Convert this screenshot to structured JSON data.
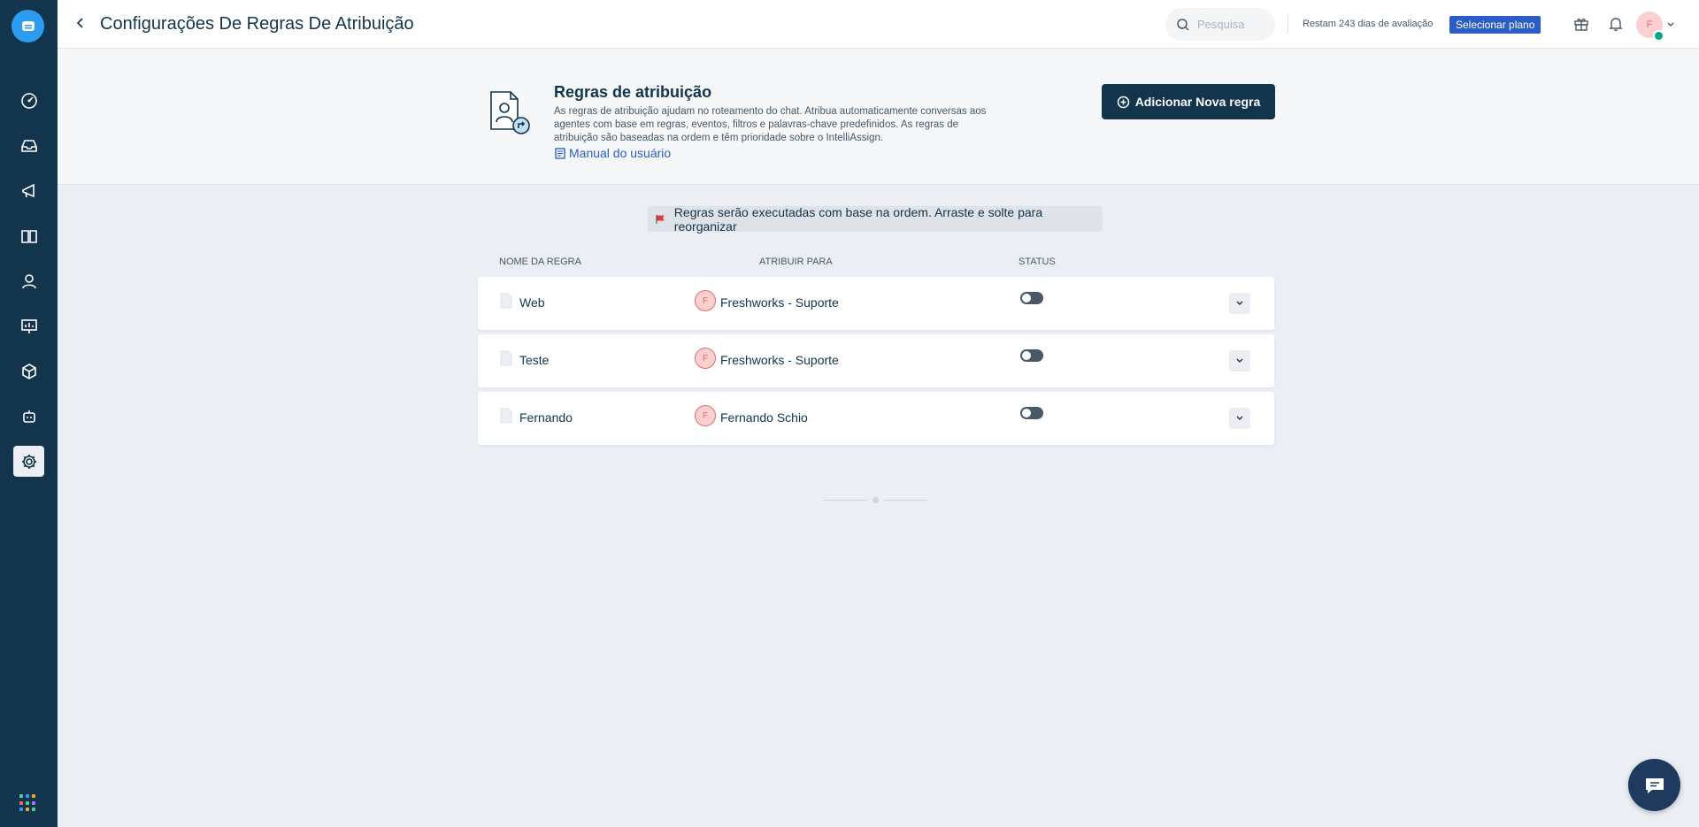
{
  "header": {
    "title": "Configurações De Regras De Atribuição",
    "search_placeholder": "Pesquisa",
    "trial_text": "Restam 243 dias de avaliação",
    "plan_button": "Selecionar plano",
    "avatar_initial": "F"
  },
  "sidebar": {
    "items": [
      {
        "name": "dashboard-icon"
      },
      {
        "name": "inbox-icon"
      },
      {
        "name": "campaigns-icon"
      },
      {
        "name": "knowledge-base-icon"
      },
      {
        "name": "contacts-icon"
      },
      {
        "name": "reports-icon"
      },
      {
        "name": "integrations-icon"
      },
      {
        "name": "bots-icon"
      },
      {
        "name": "settings-icon",
        "active": true
      }
    ]
  },
  "intro": {
    "title": "Regras de atribuição",
    "description": "As regras de atribuição ajudam no roteamento do chat. Atribua automaticamente conversas aos agentes com base em regras, eventos, filtros e palavras-chave predefinidos. As regras de atribuição são baseadas na ordem e têm prioridade sobre o IntelliAssign.",
    "link": "Manual do usuário",
    "add_button": "Adicionar Nova regra"
  },
  "info_message": "Regras serão executadas com base na ordem. Arraste e solte para reorganizar",
  "table": {
    "columns": [
      "NOME DA REGRA",
      "ATRIBUIR PARA",
      "STATUS"
    ],
    "rows": [
      {
        "name": "Web",
        "assign_initial": "F",
        "assign_to": "Freshworks - Suporte",
        "status": false
      },
      {
        "name": "Teste",
        "assign_initial": "F",
        "assign_to": "Freshworks - Suporte",
        "status": false
      },
      {
        "name": "Fernando",
        "assign_initial": "F",
        "assign_to": "Fernando Schio",
        "status": false
      }
    ]
  },
  "colors": {
    "sidebar": "#12344d",
    "accent": "#2c5cc5",
    "primary_button": "#12344d"
  }
}
